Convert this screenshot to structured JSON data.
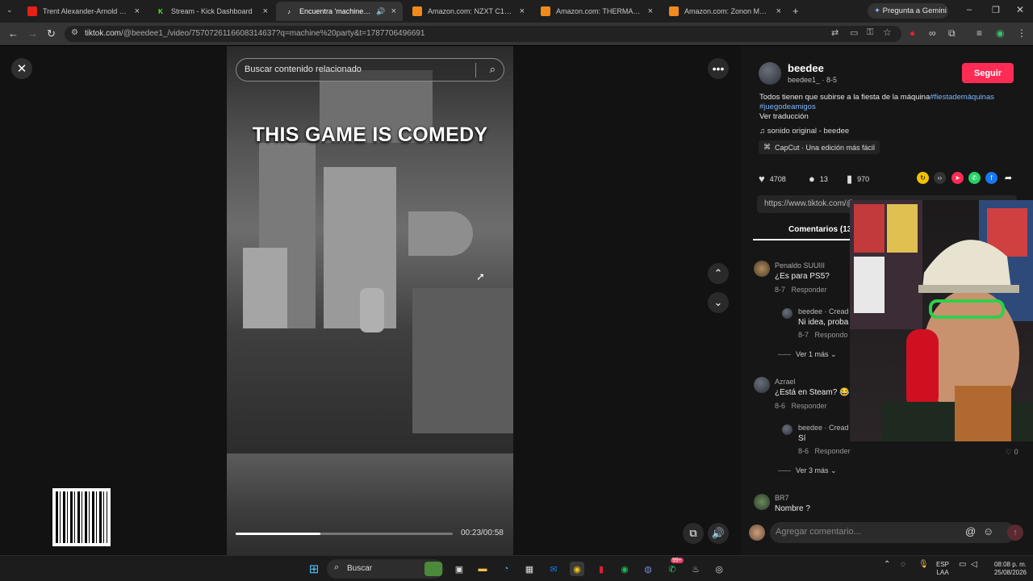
{
  "browser": {
    "tabs": [
      {
        "title": "Trent Alexander-Arnold Ultima",
        "icon": "youtube-icon",
        "active": false
      },
      {
        "title": "Stream - Kick Dashboard",
        "icon": "kick-icon",
        "active": false
      },
      {
        "title": "Encuentra 'machine party'",
        "icon": "tiktok-icon",
        "active": true
      },
      {
        "title": "Amazon.com: NZXT C1000 Gol",
        "icon": "amazon-icon",
        "active": false
      },
      {
        "title": "Amazon.com: THERMALRIGHT",
        "icon": "amazon-icon",
        "active": false
      },
      {
        "title": "Amazon.com: Zonon Marcadi",
        "icon": "amazon-icon",
        "active": false
      }
    ],
    "gemini_label": "Pregunta a Gemini",
    "url_host": "tiktok.com",
    "url_path": "/@beedee1_/video/7570726116608314637?q=machine%20party&t=1787706496691"
  },
  "video": {
    "search_placeholder": "Buscar contenido relacionado",
    "caption": "THIS GAME IS COMEDY",
    "time": "00:23/00:58",
    "progress_fraction": 0.39
  },
  "post": {
    "author": "beedee",
    "handle": "beedee1_",
    "date": "8-5",
    "follow_label": "Seguir",
    "description": "Todos tienen que subirse a la fiesta de la máquina",
    "hashtags": [
      "#fiestademáquinas",
      "#juegodeamigos"
    ],
    "translate_label": "Ver traducción",
    "sound": "sonido original - beedee",
    "capcut": "CapCut · Una edición más fácil",
    "likes": "4708",
    "comments_count": "13",
    "saves": "970",
    "share_url": "https://www.tiktok.com/@",
    "comments_tab": "Comentarios (13)"
  },
  "comments": [
    {
      "name": "Penaldo SUUIII",
      "text": "¿Es para PS5?",
      "date": "8-7",
      "reply": "Responder"
    },
    {
      "name": "beedee · Cread",
      "text": "Ni idea, proba",
      "date": "8-7",
      "reply": "Respondo",
      "nested": true
    },
    {
      "more": "Ver 1 más"
    },
    {
      "name": "Azrael",
      "text": "¿Está en Steam? 😂",
      "date": "8-6",
      "reply": "Responder"
    },
    {
      "name": "beedee · Cread",
      "text": "Sí",
      "date": "8-6",
      "reply": "Responder",
      "nested": true,
      "likes": "0"
    },
    {
      "more": "Ver 3 más"
    },
    {
      "name": "BR7",
      "text": "Nombre ?"
    }
  ],
  "composer_placeholder": "Agregar comentario...",
  "taskbar": {
    "search_label": "Buscar",
    "lang": "ESP",
    "lang2": "LAA",
    "time": "08:08 p. m.",
    "date": "25/08/2026",
    "badge": "99+"
  }
}
